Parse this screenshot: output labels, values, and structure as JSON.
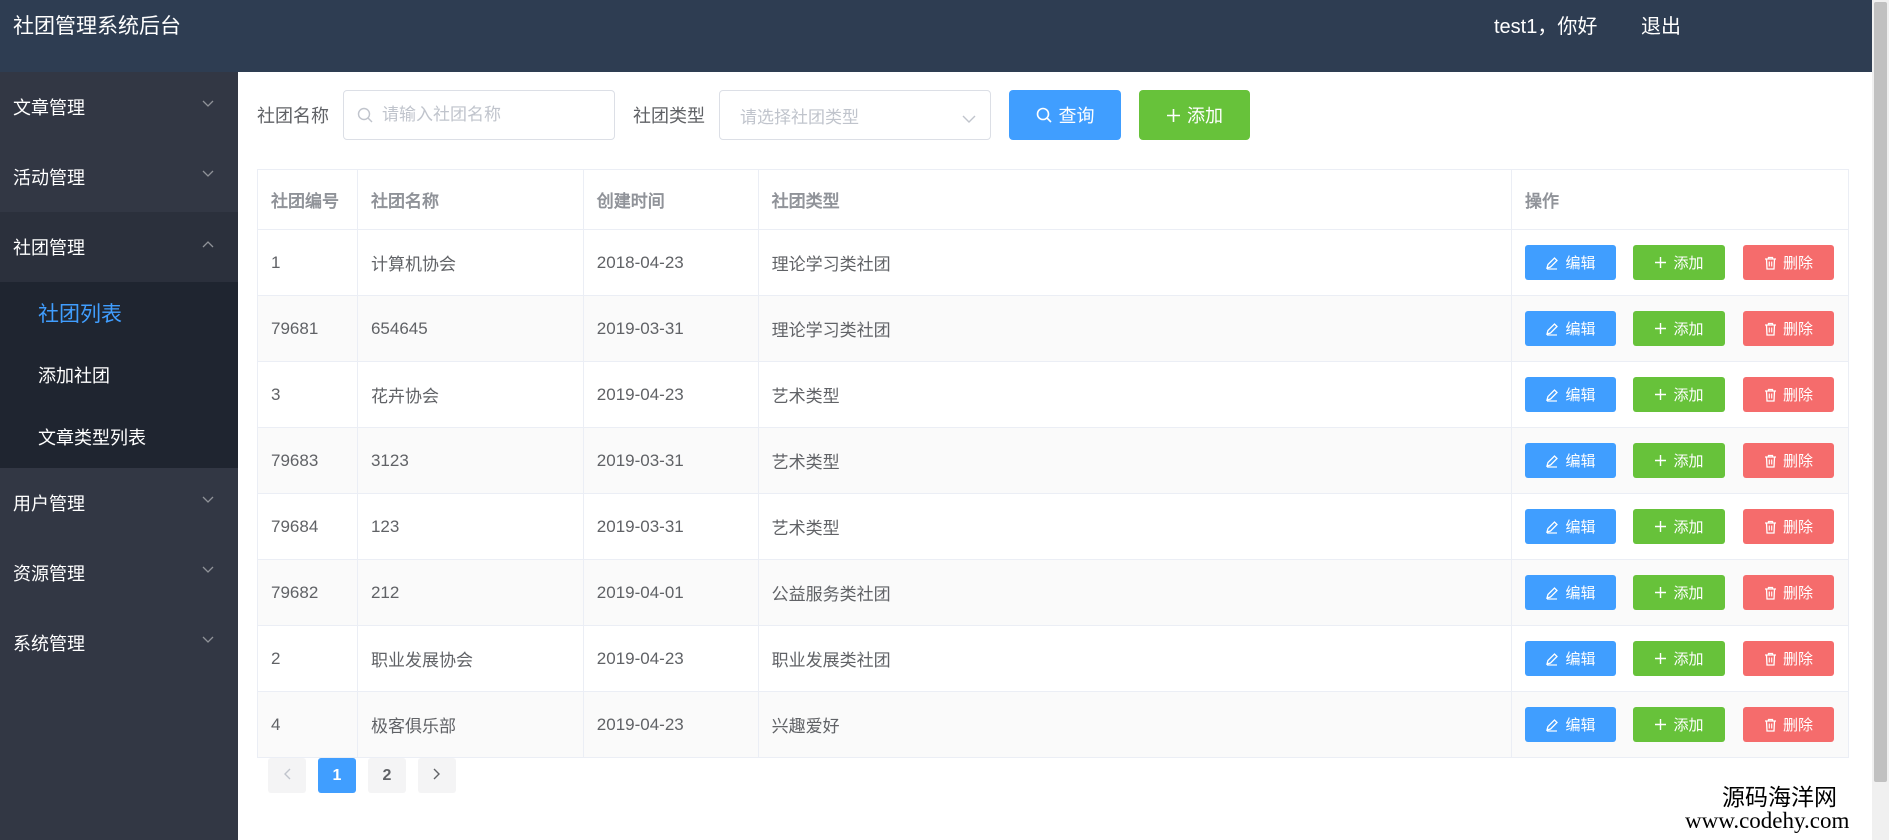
{
  "header": {
    "title": "社团管理系统后台",
    "greeting": "test1，你好",
    "logout": "退出"
  },
  "sidebar": {
    "items": [
      {
        "label": "文章管理"
      },
      {
        "label": "活动管理"
      },
      {
        "label": "社团管理",
        "open": true,
        "children": [
          {
            "label": "社团列表",
            "active": true
          },
          {
            "label": "添加社团"
          },
          {
            "label": "文章类型列表"
          }
        ]
      },
      {
        "label": "用户管理"
      },
      {
        "label": "资源管理"
      },
      {
        "label": "系统管理"
      }
    ]
  },
  "filter": {
    "name_label": "社团名称",
    "name_placeholder": "请输入社团名称",
    "type_label": "社团类型",
    "type_placeholder": "请选择社团类型",
    "query_label": "查询",
    "add_label": "添加"
  },
  "table": {
    "headers": [
      "社团编号",
      "社团名称",
      "创建时间",
      "社团类型",
      "操作"
    ],
    "action_labels": {
      "edit": "编辑",
      "add": "添加",
      "delete": "删除"
    },
    "rows": [
      {
        "id": "1",
        "name": "计算机协会",
        "created": "2018-04-23",
        "type": "理论学习类社团"
      },
      {
        "id": "79681",
        "name": "654645",
        "created": "2019-03-31",
        "type": "理论学习类社团"
      },
      {
        "id": "3",
        "name": "花卉协会",
        "created": "2019-04-23",
        "type": "艺术类型"
      },
      {
        "id": "79683",
        "name": "3123",
        "created": "2019-03-31",
        "type": "艺术类型"
      },
      {
        "id": "79684",
        "name": "123",
        "created": "2019-03-31",
        "type": "艺术类型"
      },
      {
        "id": "79682",
        "name": "212",
        "created": "2019-04-01",
        "type": "公益服务类社团"
      },
      {
        "id": "2",
        "name": "职业发展协会",
        "created": "2019-04-23",
        "type": "职业发展类社团"
      },
      {
        "id": "4",
        "name": "极客俱乐部",
        "created": "2019-04-23",
        "type": "兴趣爱好"
      }
    ]
  },
  "pagination": {
    "pages": [
      "1",
      "2"
    ],
    "current": "1"
  },
  "watermark": {
    "line1": "源码海洋网",
    "line2": "www.codehy.com"
  },
  "colors": {
    "header": "#2e3d52",
    "sidebar": "#323744",
    "primary": "#409eff",
    "success": "#67c23a",
    "danger": "#f56c6c"
  },
  "icons": [
    "chevron-down-icon",
    "chevron-up-icon",
    "search-icon",
    "plus-icon",
    "edit-icon",
    "trash-icon",
    "chevron-left-icon",
    "chevron-right-icon"
  ]
}
